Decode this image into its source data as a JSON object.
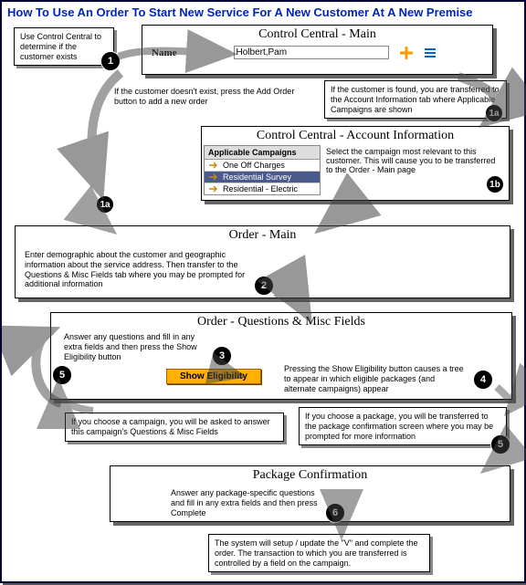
{
  "title": "How To Use An Order To Start New Service For A New Customer At A New Premise",
  "panels": {
    "cc_main": {
      "header": "Control Central - Main",
      "name_label": "Name",
      "name_value": "Holbert,Pam"
    },
    "cc_account": {
      "header": "Control Central - Account Information",
      "campaigns_header": "Applicable Campaigns",
      "campaigns": [
        {
          "label": "One Off Charges"
        },
        {
          "label": "Residential Survey"
        },
        {
          "label": "Residential - Electric"
        }
      ]
    },
    "order_main": {
      "header": "Order - Main"
    },
    "order_qmf": {
      "header": "Order - Questions & Misc Fields",
      "show_eligibility_btn": "Show Eligibility"
    },
    "pkg_conf": {
      "header": "Package Confirmation"
    }
  },
  "callouts": {
    "use_cc": "Use Control Central to determine if the customer exists",
    "if_not_exist": "If the customer doesn't exist, press the Add Order button to add a new order",
    "if_found": "If the customer is found, you are transferred to the Account Information tab where Applicable Campaigns are shown",
    "select_campaign": "Select the campaign most relevant to this customer.  This will cause you to be transferred to the Order - Main page",
    "enter_demo": "Enter demographic about the customer and geographic information about the service address.  Then transfer to the Questions & Misc Fields tab where you may be prompted for additional information",
    "answer_q": "Answer any questions and fill in any extra fields and then press the Show Eligibility button",
    "press_show_elig": "Pressing the Show Eligibility button causes a tree to appear in which eligible packages (and alternate campaigns) appear",
    "choose_campaign": "If you choose a campaign, you will be asked to answer this campaign's Questions & Misc Fields",
    "choose_pkg": "If you choose a package, you will be transferred to the package confirmation screen where you may be prompted for more information",
    "answer_pkg": "Answer any package-specific questions and fill in any extra fields and then press Complete",
    "system_setup": "The system will setup / update the \"V\" and complete the order.  The transaction to which you are transferred is controlled by a field on the campaign."
  },
  "step_labels": {
    "s1": "1",
    "s1a": "1a",
    "s1b": "1b",
    "s2": "2",
    "s3": "3",
    "s4": "4",
    "s5": "5",
    "s6": "6"
  }
}
